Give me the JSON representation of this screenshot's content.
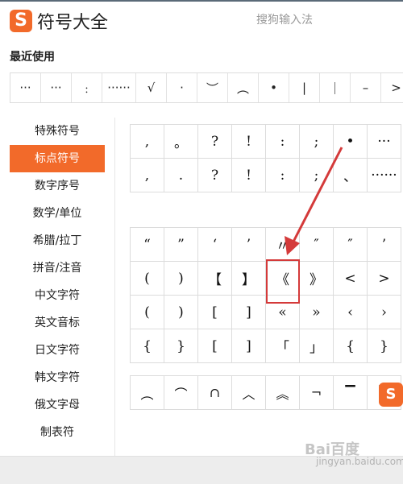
{
  "header": {
    "logo_letter": "S",
    "title": "符号大全",
    "brand": "搜狗输入法"
  },
  "recent": {
    "title": "最近使用",
    "items": [
      "···",
      "···",
      "﹕",
      "······",
      "√",
      "·",
      "︶",
      "︵",
      "•",
      "|",
      "｜",
      "–",
      ">"
    ]
  },
  "sidebar": {
    "items": [
      {
        "label": "特殊符号",
        "active": false
      },
      {
        "label": "标点符号",
        "active": true
      },
      {
        "label": "数字序号",
        "active": false
      },
      {
        "label": "数学/单位",
        "active": false
      },
      {
        "label": "希腊/拉丁",
        "active": false
      },
      {
        "label": "拼音/注音",
        "active": false
      },
      {
        "label": "中文字符",
        "active": false
      },
      {
        "label": "英文音标",
        "active": false
      },
      {
        "label": "日文字符",
        "active": false
      },
      {
        "label": "韩文字符",
        "active": false
      },
      {
        "label": "俄文字母",
        "active": false
      },
      {
        "label": "制表符",
        "active": false
      }
    ]
  },
  "grid1": {
    "cells": [
      ",",
      "。",
      "?",
      "!",
      ":",
      ";",
      "•",
      "···",
      ",",
      ".",
      "?",
      "!",
      ":",
      ";",
      "、",
      "······"
    ]
  },
  "grid2": {
    "cells": [
      "“",
      "”",
      "‘",
      "’",
      "〃",
      "″",
      "″",
      "’",
      "(",
      ")",
      "【",
      "】",
      "《",
      "》",
      "<",
      ">",
      "(",
      ")",
      "[",
      "]",
      "«",
      "»",
      "‹",
      "›",
      "{",
      "}",
      "[",
      "]",
      "「",
      "」",
      "{",
      "}"
    ]
  },
  "grid3": {
    "cells": [
      "︵",
      "⌒",
      "∩",
      "︿",
      "︽",
      "¬",
      "▔",
      "▛"
    ]
  },
  "annotation": {
    "highlight_color": "#d43a3a",
    "highlighted_symbol": "《"
  },
  "watermark": {
    "text": "Bai百度",
    "sub": "jingyan.baidu.com"
  },
  "colors": {
    "accent": "#f26a2a",
    "annotation": "#d43a3a"
  }
}
